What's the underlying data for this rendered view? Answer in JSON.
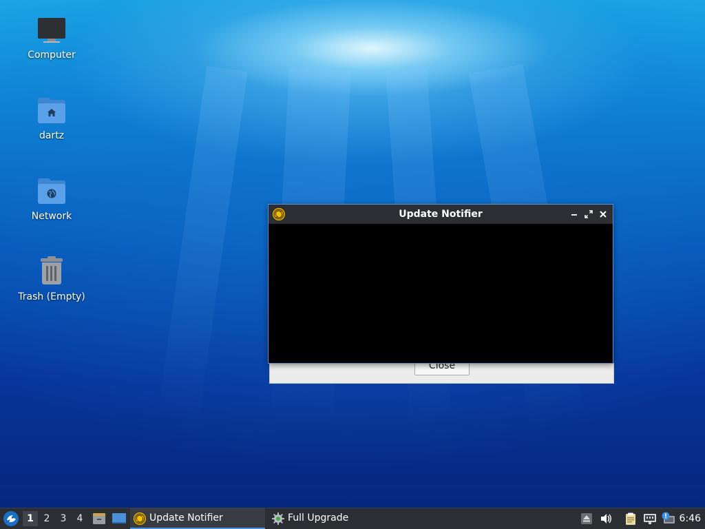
{
  "desktop": {
    "icons": [
      {
        "label": "Computer"
      },
      {
        "label": "dartz"
      },
      {
        "label": "Network"
      },
      {
        "label": "Trash (Empty)"
      }
    ]
  },
  "window": {
    "title": "Update Notifier",
    "close_button_label": "Close",
    "controls": [
      "minimize-icon",
      "maximize-icon",
      "close-icon"
    ]
  },
  "taskbar": {
    "workspaces": [
      "1",
      "2",
      "3",
      "4"
    ],
    "active_workspace": "1",
    "tasks": [
      {
        "label": "Update Notifier",
        "icon": "update-notifier-icon",
        "active": true
      },
      {
        "label": "Full Upgrade",
        "icon": "gear-icon",
        "active": false
      }
    ],
    "tray_icons": [
      "eject-icon",
      "volume-icon",
      "clipboard-icon",
      "network-wired-icon",
      "update-alert-icon"
    ],
    "clock": "6:46"
  },
  "colors": {
    "taskbar_bg": "#2b2e33",
    "titlebar_bg": "#2c2e33",
    "accent": "#4a90d9",
    "update_icon_yellow": "#f2c200"
  }
}
